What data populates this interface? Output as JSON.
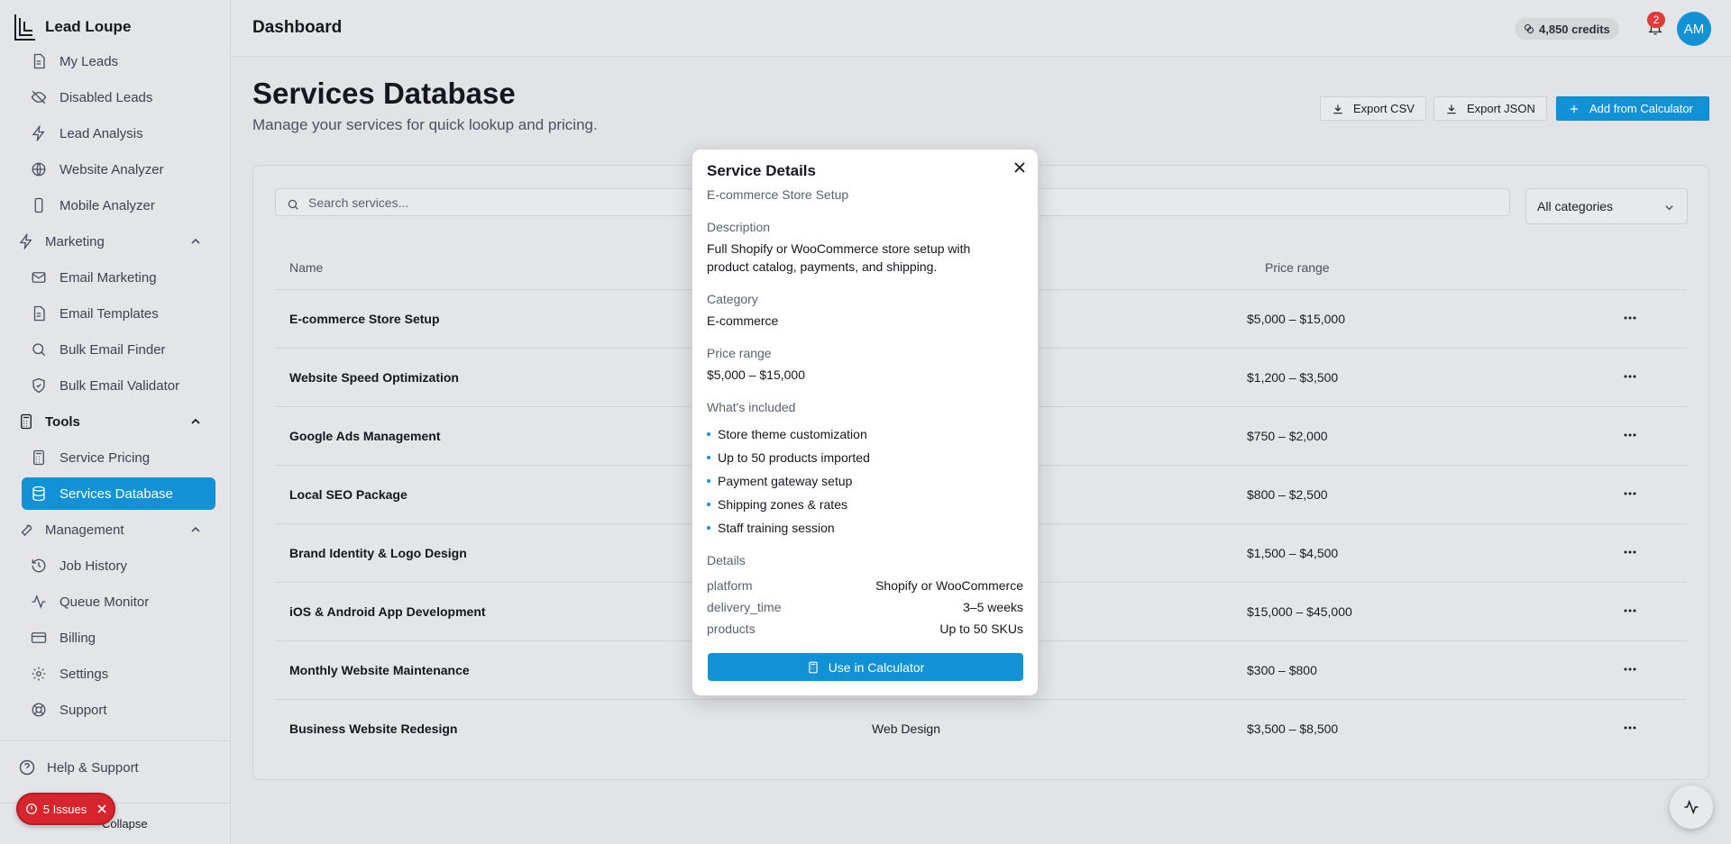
{
  "brand": {
    "name": "Lead Loupe"
  },
  "sidebar": {
    "items": [
      {
        "label": "My Leads",
        "icon": "file-icon"
      },
      {
        "label": "Disabled Leads",
        "icon": "eye-off-icon"
      },
      {
        "label": "Lead Analysis",
        "icon": "bolt-icon"
      },
      {
        "label": "Website Analyzer",
        "icon": "globe-icon"
      },
      {
        "label": "Mobile Analyzer",
        "icon": "phone-icon"
      }
    ],
    "marketing": {
      "label": "Marketing",
      "items": [
        {
          "label": "Email Marketing",
          "icon": "mail-icon"
        },
        {
          "label": "Email Templates",
          "icon": "file-icon"
        },
        {
          "label": "Bulk Email Finder",
          "icon": "search-icon"
        },
        {
          "label": "Bulk Email Validator",
          "icon": "shield-icon"
        }
      ]
    },
    "tools": {
      "label": "Tools",
      "items": [
        {
          "label": "Service Pricing",
          "icon": "calculator-icon"
        },
        {
          "label": "Services Database",
          "icon": "database-icon",
          "active": true
        }
      ]
    },
    "management": {
      "label": "Management",
      "items": [
        {
          "label": "Job History",
          "icon": "history-icon"
        },
        {
          "label": "Queue Monitor",
          "icon": "activity-icon"
        },
        {
          "label": "Billing",
          "icon": "card-icon"
        },
        {
          "label": "Settings",
          "icon": "gear-icon"
        },
        {
          "label": "Support",
          "icon": "lifebuoy-icon"
        }
      ]
    },
    "help_label": "Help & Support",
    "collapse_label": "Collapse",
    "issues_label": "5 Issues"
  },
  "header": {
    "title": "Dashboard",
    "credits": "4,850 credits",
    "notifications": "2",
    "avatar": "AM"
  },
  "main": {
    "title": "Services Database",
    "subtitle": "Manage your services for quick lookup and pricing.",
    "export_csv": "Export CSV",
    "export_json": "Export JSON",
    "add_calculator": "Add from Calculator",
    "search_placeholder": "Search services...",
    "category_filter": "All categories",
    "columns": {
      "name": "Name",
      "price": "Price range"
    },
    "rows": [
      {
        "name": "E-commerce Store Setup",
        "category": "",
        "price": "$5,000 – $15,000"
      },
      {
        "name": "Website Speed Optimization",
        "category": "",
        "price": "$1,200 – $3,500"
      },
      {
        "name": "Google Ads Management",
        "category": "",
        "price": "$750 – $2,000"
      },
      {
        "name": "Local SEO Package",
        "category": "",
        "price": "$800 – $2,500"
      },
      {
        "name": "Brand Identity & Logo Design",
        "category": "",
        "price": "$1,500 – $4,500"
      },
      {
        "name": "iOS & Android App Development",
        "category": "",
        "price": "$15,000 – $45,000"
      },
      {
        "name": "Monthly Website Maintenance",
        "category": "",
        "price": "$300 – $800"
      },
      {
        "name": "Business Website Redesign",
        "category": "Web Design",
        "price": "$3,500 – $8,500"
      }
    ]
  },
  "modal": {
    "title": "Service Details",
    "subtitle": "E-commerce Store Setup",
    "description_label": "Description",
    "description": "Full Shopify or WooCommerce store setup with product catalog, payments, and shipping.",
    "category_label": "Category",
    "category": "E-commerce",
    "price_label": "Price range",
    "price": "$5,000 – $15,000",
    "included_label": "What's included",
    "included": [
      "Store theme customization",
      "Up to 50 products imported",
      "Payment gateway setup",
      "Shipping zones & rates",
      "Staff training session"
    ],
    "details_label": "Details",
    "details": [
      {
        "key": "platform",
        "value": "Shopify or WooCommerce"
      },
      {
        "key": "delivery_time",
        "value": "3–5 weeks"
      },
      {
        "key": "products",
        "value": "Up to 50 SKUs"
      }
    ],
    "use_button": "Use in Calculator"
  },
  "colors": {
    "accent": "#1192d6",
    "danger": "#d8242d"
  }
}
